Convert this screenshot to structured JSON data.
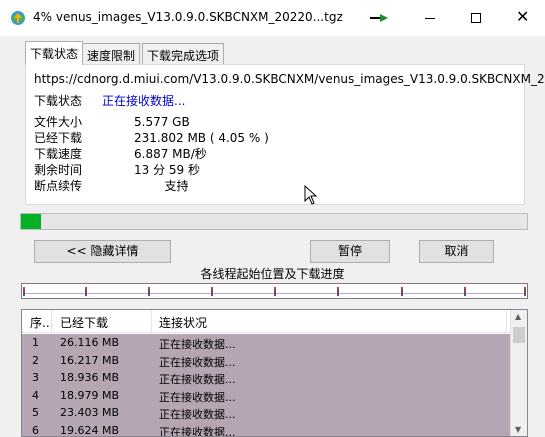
{
  "window": {
    "title": "4% venus_images_V13.0.9.0.SKBCNXM_20220...tgz"
  },
  "tabs": [
    {
      "label": "下载状态",
      "active": true
    },
    {
      "label": "速度限制",
      "active": false
    },
    {
      "label": "下载完成选项",
      "active": false
    }
  ],
  "panel": {
    "url": "https://cdnorg.d.miui.com/V13.0.9.0.SKBCNXM/venus_images_V13.0.9.0.SKBCNXM_2",
    "status_label": "下载状态",
    "status_value": "正在接收数据...",
    "info": [
      {
        "label": "文件大小",
        "value": "5.577  GB"
      },
      {
        "label": "已经下载",
        "value": "231.802  MB  ( 4.05 % )"
      },
      {
        "label": "下载速度",
        "value": "6.887  MB/秒"
      },
      {
        "label": "剩余时间",
        "value": "13 分 59 秒"
      },
      {
        "label": "断点续传",
        "value": "        支持"
      }
    ]
  },
  "progress": {
    "percent": 4.05
  },
  "buttons": {
    "hide_details": "<< 隐藏详情",
    "pause": "暂停",
    "cancel": "取消"
  },
  "threads": {
    "label": "各线程起始位置及下载进度"
  },
  "list": {
    "headers": [
      "序...",
      "已经下载",
      "连接状况"
    ],
    "rows": [
      {
        "id": "1",
        "downloaded": "26.116  MB",
        "status": "正在接收数据..."
      },
      {
        "id": "2",
        "downloaded": "16.217  MB",
        "status": "正在接收数据..."
      },
      {
        "id": "3",
        "downloaded": "18.936  MB",
        "status": "正在接收数据..."
      },
      {
        "id": "4",
        "downloaded": "18.979  MB",
        "status": "正在接收数据..."
      },
      {
        "id": "5",
        "downloaded": "23.403  MB",
        "status": "正在接收数据..."
      },
      {
        "id": "6",
        "downloaded": "19.624  MB",
        "status": "正在接收数据..."
      }
    ]
  },
  "icons": {
    "app": "download-globe-icon",
    "minimize_to_tray": "green-arrow-icon"
  },
  "colors": {
    "progress_fill": "#06b025",
    "row_highlight": "#b6a6b3",
    "status_link": "#0000cc"
  }
}
